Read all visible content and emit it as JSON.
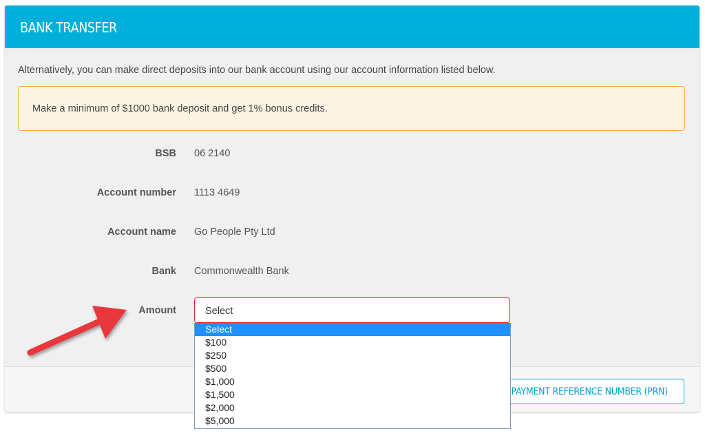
{
  "header": {
    "title": "BANK TRANSFER"
  },
  "intro": "Alternatively, you can make direct deposits into our bank account using our account information listed below.",
  "alert": {
    "text": "Make a minimum of $1000 bank deposit and get 1% bonus credits."
  },
  "details": {
    "bsb": {
      "label": "BSB",
      "value": "06 2140"
    },
    "account_number": {
      "label": "Account number",
      "value": "1113 4649"
    },
    "account_name": {
      "label": "Account name",
      "value": "Go People Pty Ltd"
    },
    "bank": {
      "label": "Bank",
      "value": "Commonwealth Bank"
    },
    "amount": {
      "label": "Amount"
    }
  },
  "amount_select": {
    "value": "Select",
    "options": [
      "Select",
      "$100",
      "$250",
      "$500",
      "$1,000",
      "$1,500",
      "$2,000",
      "$5,000"
    ],
    "highlighted_index": 0
  },
  "footer": {
    "button_label": "GET PAYMENT REFERENCE NUMBER (PRN)"
  },
  "colors": {
    "header_bg": "#00b0da",
    "alert_border": "#f0ad4e",
    "alert_bg": "#fcf3e2",
    "select_border": "#d9242c",
    "highlight": "#1e90ff",
    "arrow": "#e8383d"
  },
  "icons": {
    "annotation": "red-arrow-icon"
  }
}
